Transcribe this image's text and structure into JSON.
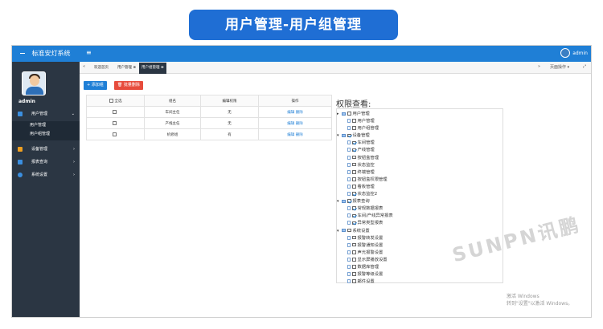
{
  "banner": {
    "title": "用户管理-用户组管理"
  },
  "header": {
    "app_title": "标准安灯系统",
    "menu_toggle": "≡",
    "user_name": "admin"
  },
  "sidebar": {
    "admin_name": "admin",
    "items": [
      {
        "label": "用户管理",
        "icon": "user-icon",
        "arrow": "⌄",
        "color": "#3b8fe0"
      },
      {
        "label": "设备管理",
        "icon": "wrench-icon",
        "arrow": "›",
        "color": "#f0a020"
      },
      {
        "label": "报表查询",
        "icon": "report-icon",
        "arrow": "›",
        "color": "#3b8fe0"
      },
      {
        "label": "系统设置",
        "icon": "gear-icon",
        "arrow": "›",
        "color": "#3b8fe0"
      }
    ],
    "sub_items": [
      {
        "label": "用户管理"
      },
      {
        "label": "用户组管理"
      }
    ]
  },
  "tabs": {
    "prev": "«",
    "items": [
      {
        "label": "欢迎首页"
      },
      {
        "label": "用户管理 ⊗"
      },
      {
        "label": "用户组管理 ⊗"
      }
    ],
    "next": "»",
    "page_ops": "页面操作 ▾",
    "fullscreen": "⤢"
  },
  "toolbar": {
    "add_label": "+ 添加组",
    "delete_label": "🗑 批量删除"
  },
  "table": {
    "headers": [
      "全选",
      "组名",
      "编辑权限",
      "操作"
    ],
    "rows": [
      {
        "name": "车间主任",
        "perm": "无",
        "ops": "编辑 删除"
      },
      {
        "name": "产线主任",
        "perm": "无",
        "ops": "编辑 删除"
      },
      {
        "name": "机修组",
        "perm": "有",
        "ops": "编辑 删除"
      }
    ]
  },
  "permissions": {
    "title": "权限查看:",
    "tree": [
      {
        "label": "用户管理",
        "level": 0,
        "checked": false,
        "fold": "▸"
      },
      {
        "label": "用户管理",
        "level": 1,
        "checked": false
      },
      {
        "label": "用户组管理",
        "level": 1,
        "checked": false
      },
      {
        "label": "设备管理",
        "level": 0,
        "checked": true,
        "fold": "▾"
      },
      {
        "label": "车间管理",
        "level": 1,
        "checked": true
      },
      {
        "label": "产线管理",
        "level": 1,
        "checked": true
      },
      {
        "label": "按钮盒管理",
        "level": 1,
        "checked": false
      },
      {
        "label": "状态监控",
        "level": 1,
        "checked": false
      },
      {
        "label": "终端管理",
        "level": 1,
        "checked": false
      },
      {
        "label": "按钮盒权限管理",
        "level": 1,
        "checked": false
      },
      {
        "label": "看板管理",
        "level": 1,
        "checked": false
      },
      {
        "label": "状态监控2",
        "level": 1,
        "checked": true
      },
      {
        "label": "报表查询",
        "level": 0,
        "checked": true,
        "fold": "▾"
      },
      {
        "label": "常规数据报表",
        "level": 1,
        "checked": true
      },
      {
        "label": "车间/产线异常报表",
        "level": 1,
        "checked": true
      },
      {
        "label": "异常类型报表",
        "level": 1,
        "checked": true
      },
      {
        "label": "系统设置",
        "level": 0,
        "checked": false,
        "fold": "▾"
      },
      {
        "label": "报警转发设置",
        "level": 1,
        "checked": false
      },
      {
        "label": "报警通知设置",
        "level": 1,
        "checked": false
      },
      {
        "label": "声光报警设置",
        "level": 1,
        "checked": false
      },
      {
        "label": "显示屏播放设置",
        "level": 1,
        "checked": false
      },
      {
        "label": "数据库管理",
        "level": 1,
        "checked": false
      },
      {
        "label": "报警等级设置",
        "level": 1,
        "checked": false
      },
      {
        "label": "邮件设置",
        "level": 1,
        "checked": false
      }
    ]
  },
  "watermark": "SUNPN讯鹏",
  "windows": {
    "line1": "激活 Windows",
    "line2": "转到\"设置\"以激活 Windows。"
  }
}
